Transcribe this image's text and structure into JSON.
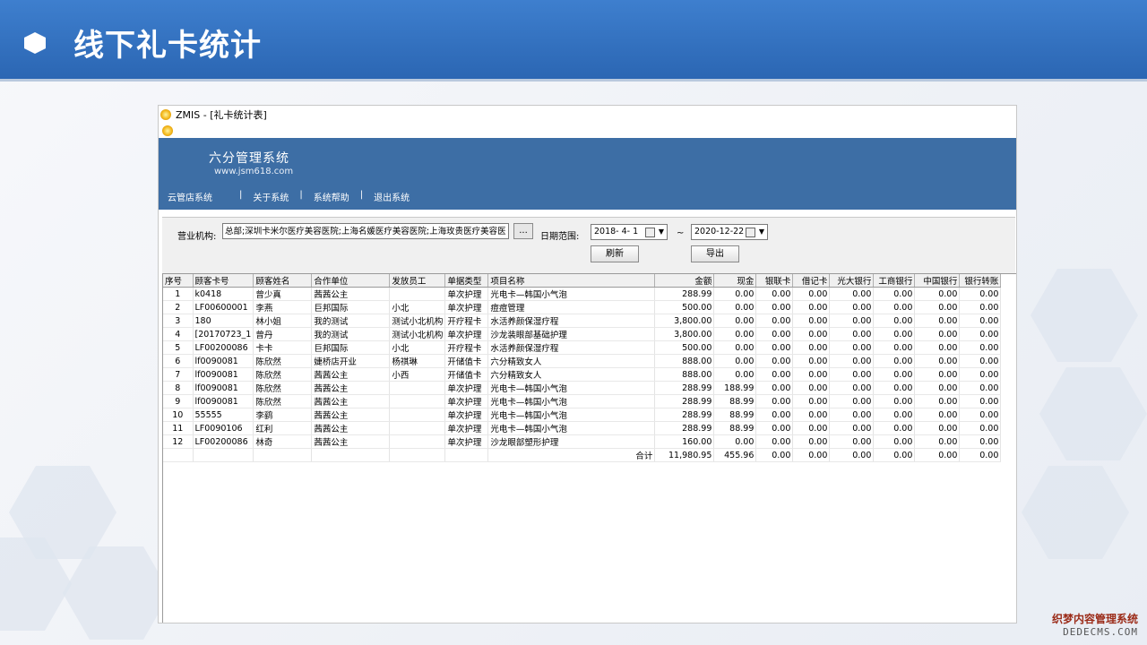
{
  "slide": {
    "title": "线下礼卡统计"
  },
  "window": {
    "title": "ZMIS - [礼卡统计表]",
    "banner_title": "六分管理系统",
    "banner_url": "www.jsm618.com",
    "menu": [
      "云管店系统",
      "关于系统",
      "系统帮助",
      "退出系统"
    ],
    "menu_sep": "|"
  },
  "filter": {
    "org_label": "营业机构:",
    "org_value": "总部;深圳卡米尔医疗美容医院;上海名媛医疗美容医院;上海玫贵医疗美容医",
    "dots_label": "...",
    "date_label": "日期范围:",
    "date_from": "2018- 4- 1",
    "date_sep": "~",
    "date_to": "2020-12-22",
    "refresh_label": "刷新",
    "export_label": "导出"
  },
  "grid": {
    "columns": [
      "序号",
      "顾客卡号",
      "顾客姓名",
      "合作单位",
      "发放员工",
      "单据类型",
      "项目名称",
      "金额",
      "现金",
      "银联卡",
      "借记卡",
      "光大银行",
      "工商银行",
      "中国银行",
      "银行转账"
    ],
    "rows": [
      [
        "1",
        "k0418",
        "曾少真",
        "茜茜公主",
        "",
        "单次护理",
        "光电卡—韩国小气泡",
        "288.99",
        "0.00",
        "0.00",
        "0.00",
        "0.00",
        "0.00",
        "0.00",
        "0.00"
      ],
      [
        "2",
        "LF00600001",
        "李燕",
        "巨邦国际",
        "小北",
        "单次护理",
        "痘痘管理",
        "500.00",
        "0.00",
        "0.00",
        "0.00",
        "0.00",
        "0.00",
        "0.00",
        "0.00"
      ],
      [
        "3",
        "180",
        "林小姐",
        "我的测试",
        "测试小北机构",
        "开疗程卡",
        "水活养颜保湿疗程",
        "3,800.00",
        "0.00",
        "0.00",
        "0.00",
        "0.00",
        "0.00",
        "0.00",
        "0.00"
      ],
      [
        "4",
        "[20170723_1",
        "曾丹",
        "我的测试",
        "测试小北机构",
        "单次护理",
        "沙龙装眼部基础护理",
        "3,800.00",
        "0.00",
        "0.00",
        "0.00",
        "0.00",
        "0.00",
        "0.00",
        "0.00"
      ],
      [
        "5",
        "LF00200086",
        "卡卡",
        "巨邦国际",
        "小北",
        "开疗程卡",
        "水活养颜保湿疗程",
        "500.00",
        "0.00",
        "0.00",
        "0.00",
        "0.00",
        "0.00",
        "0.00",
        "0.00"
      ],
      [
        "6",
        "lf0090081",
        "陈欣然",
        "婕桥店开业",
        "杨祺琳",
        "开储值卡",
        "六分精致女人",
        "888.00",
        "0.00",
        "0.00",
        "0.00",
        "0.00",
        "0.00",
        "0.00",
        "0.00"
      ],
      [
        "7",
        "lf0090081",
        "陈欣然",
        "茜茜公主",
        "小西",
        "开储值卡",
        "六分精致女人",
        "888.00",
        "0.00",
        "0.00",
        "0.00",
        "0.00",
        "0.00",
        "0.00",
        "0.00"
      ],
      [
        "8",
        "lf0090081",
        "陈欣然",
        "茜茜公主",
        "",
        "单次护理",
        "光电卡—韩国小气泡",
        "288.99",
        "188.99",
        "0.00",
        "0.00",
        "0.00",
        "0.00",
        "0.00",
        "0.00"
      ],
      [
        "9",
        "lf0090081",
        "陈欣然",
        "茜茜公主",
        "",
        "单次护理",
        "光电卡—韩国小气泡",
        "288.99",
        "88.99",
        "0.00",
        "0.00",
        "0.00",
        "0.00",
        "0.00",
        "0.00"
      ],
      [
        "10",
        "55555",
        "李鹞",
        "茜茜公主",
        "",
        "单次护理",
        "光电卡—韩国小气泡",
        "288.99",
        "88.99",
        "0.00",
        "0.00",
        "0.00",
        "0.00",
        "0.00",
        "0.00"
      ],
      [
        "11",
        "LF0090106",
        "红利",
        "茜茜公主",
        "",
        "单次护理",
        "光电卡—韩国小气泡",
        "288.99",
        "88.99",
        "0.00",
        "0.00",
        "0.00",
        "0.00",
        "0.00",
        "0.00"
      ],
      [
        "12",
        "LF00200086",
        "林奇",
        "茜茜公主",
        "",
        "单次护理",
        "沙龙眼部塑形护理",
        "160.00",
        "0.00",
        "0.00",
        "0.00",
        "0.00",
        "0.00",
        "0.00",
        "0.00"
      ]
    ],
    "total_label": "合计",
    "totals": [
      "11,980.95",
      "455.96",
      "0.00",
      "0.00",
      "0.00",
      "0.00",
      "0.00",
      "0.00"
    ]
  },
  "watermark": {
    "line1": "织梦内容管理系统",
    "line2": "DEDECMS.COM"
  }
}
